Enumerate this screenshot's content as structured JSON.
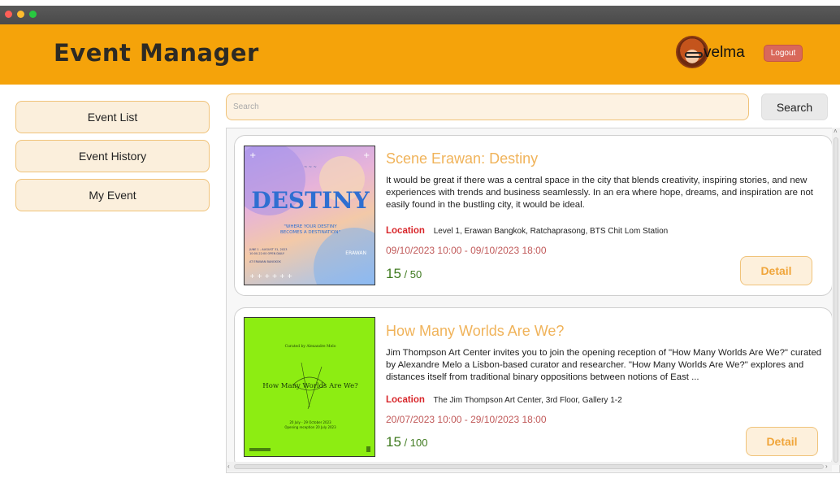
{
  "app": {
    "title": "Event Manager"
  },
  "colors": {
    "header": "#f5a30a",
    "accent": "#f0b35a",
    "location": "#d8262a",
    "datetime": "#c15a5a",
    "count": "#3f7a1f",
    "logout": "#d9685a"
  },
  "user": {
    "name": "velma",
    "avatar_icon": "user-avatar-icon",
    "logout_label": "Logout"
  },
  "sidebar": {
    "items": [
      {
        "label": "Event List"
      },
      {
        "label": "Event History"
      },
      {
        "label": "My Event"
      }
    ]
  },
  "search": {
    "placeholder": "Search",
    "button_label": "Search"
  },
  "events": [
    {
      "title": "Scene Erawan: Destiny",
      "description": "It would be great if there was a central space in the city that blends creativity, inspiring stories, and new experiences with trends and business seamlessly. In an era where hope, dreams, and inspiration are not easily found in the bustling city, it would be ideal.",
      "location_label": "Location",
      "location": "Level 1, Erawan Bangkok, Ratchaprasong, BTS Chit Lom Station",
      "datetime": "09/10/2023 10:00 - 09/10/2023 18:00",
      "count_current": "15",
      "count_separator": " / ",
      "count_max": "50",
      "detail_label": "Detail",
      "poster": {
        "heading": "DESTINY",
        "tagline": "\"WHERE YOUR DESTINY BECOMES A DESTINATION\"",
        "brand": "ERAWAN"
      }
    },
    {
      "title": "How Many Worlds Are We?",
      "description": "Jim Thompson Art Center invites you to join the opening reception of \"How Many Worlds Are We?\" curated by Alexandre Melo a Lisbon-based curator and researcher. \"How Many Worlds Are We?\" explores and distances itself from traditional binary oppositions between notions of East ...",
      "location_label": "Location",
      "location": "The Jim Thompson Art Center, 3rd Floor, Gallery 1-2",
      "datetime": "20/07/2023 10:00 - 29/10/2023 18:00",
      "count_current": "15",
      "count_separator": " / ",
      "count_max": "100",
      "detail_label": "Detail",
      "poster": {
        "heading": "How Many Worlds Are We?"
      }
    }
  ]
}
